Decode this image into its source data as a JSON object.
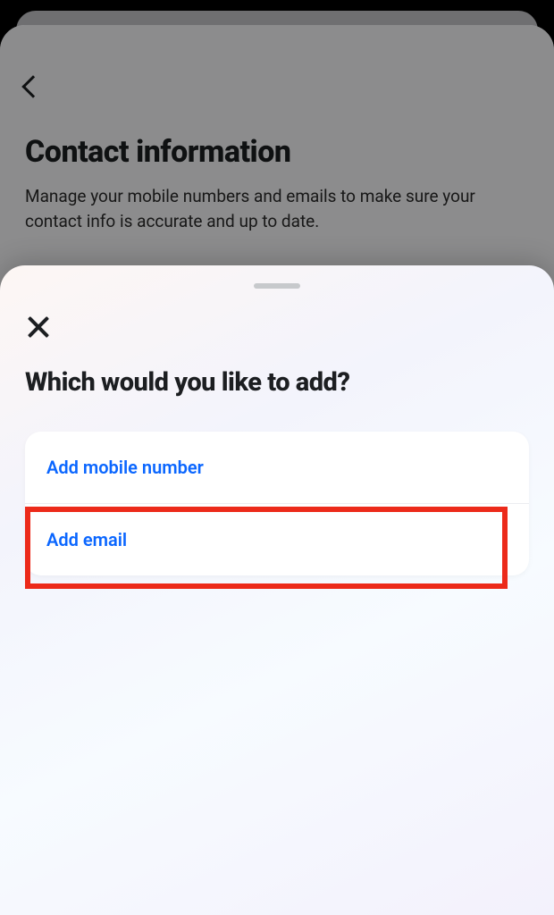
{
  "page": {
    "title": "Contact information",
    "subtitle": "Manage your mobile numbers and emails to make sure your contact info is accurate and up to date."
  },
  "sheet": {
    "title": "Which would you like to add?",
    "options": {
      "mobile": "Add mobile number",
      "email": "Add email"
    }
  }
}
